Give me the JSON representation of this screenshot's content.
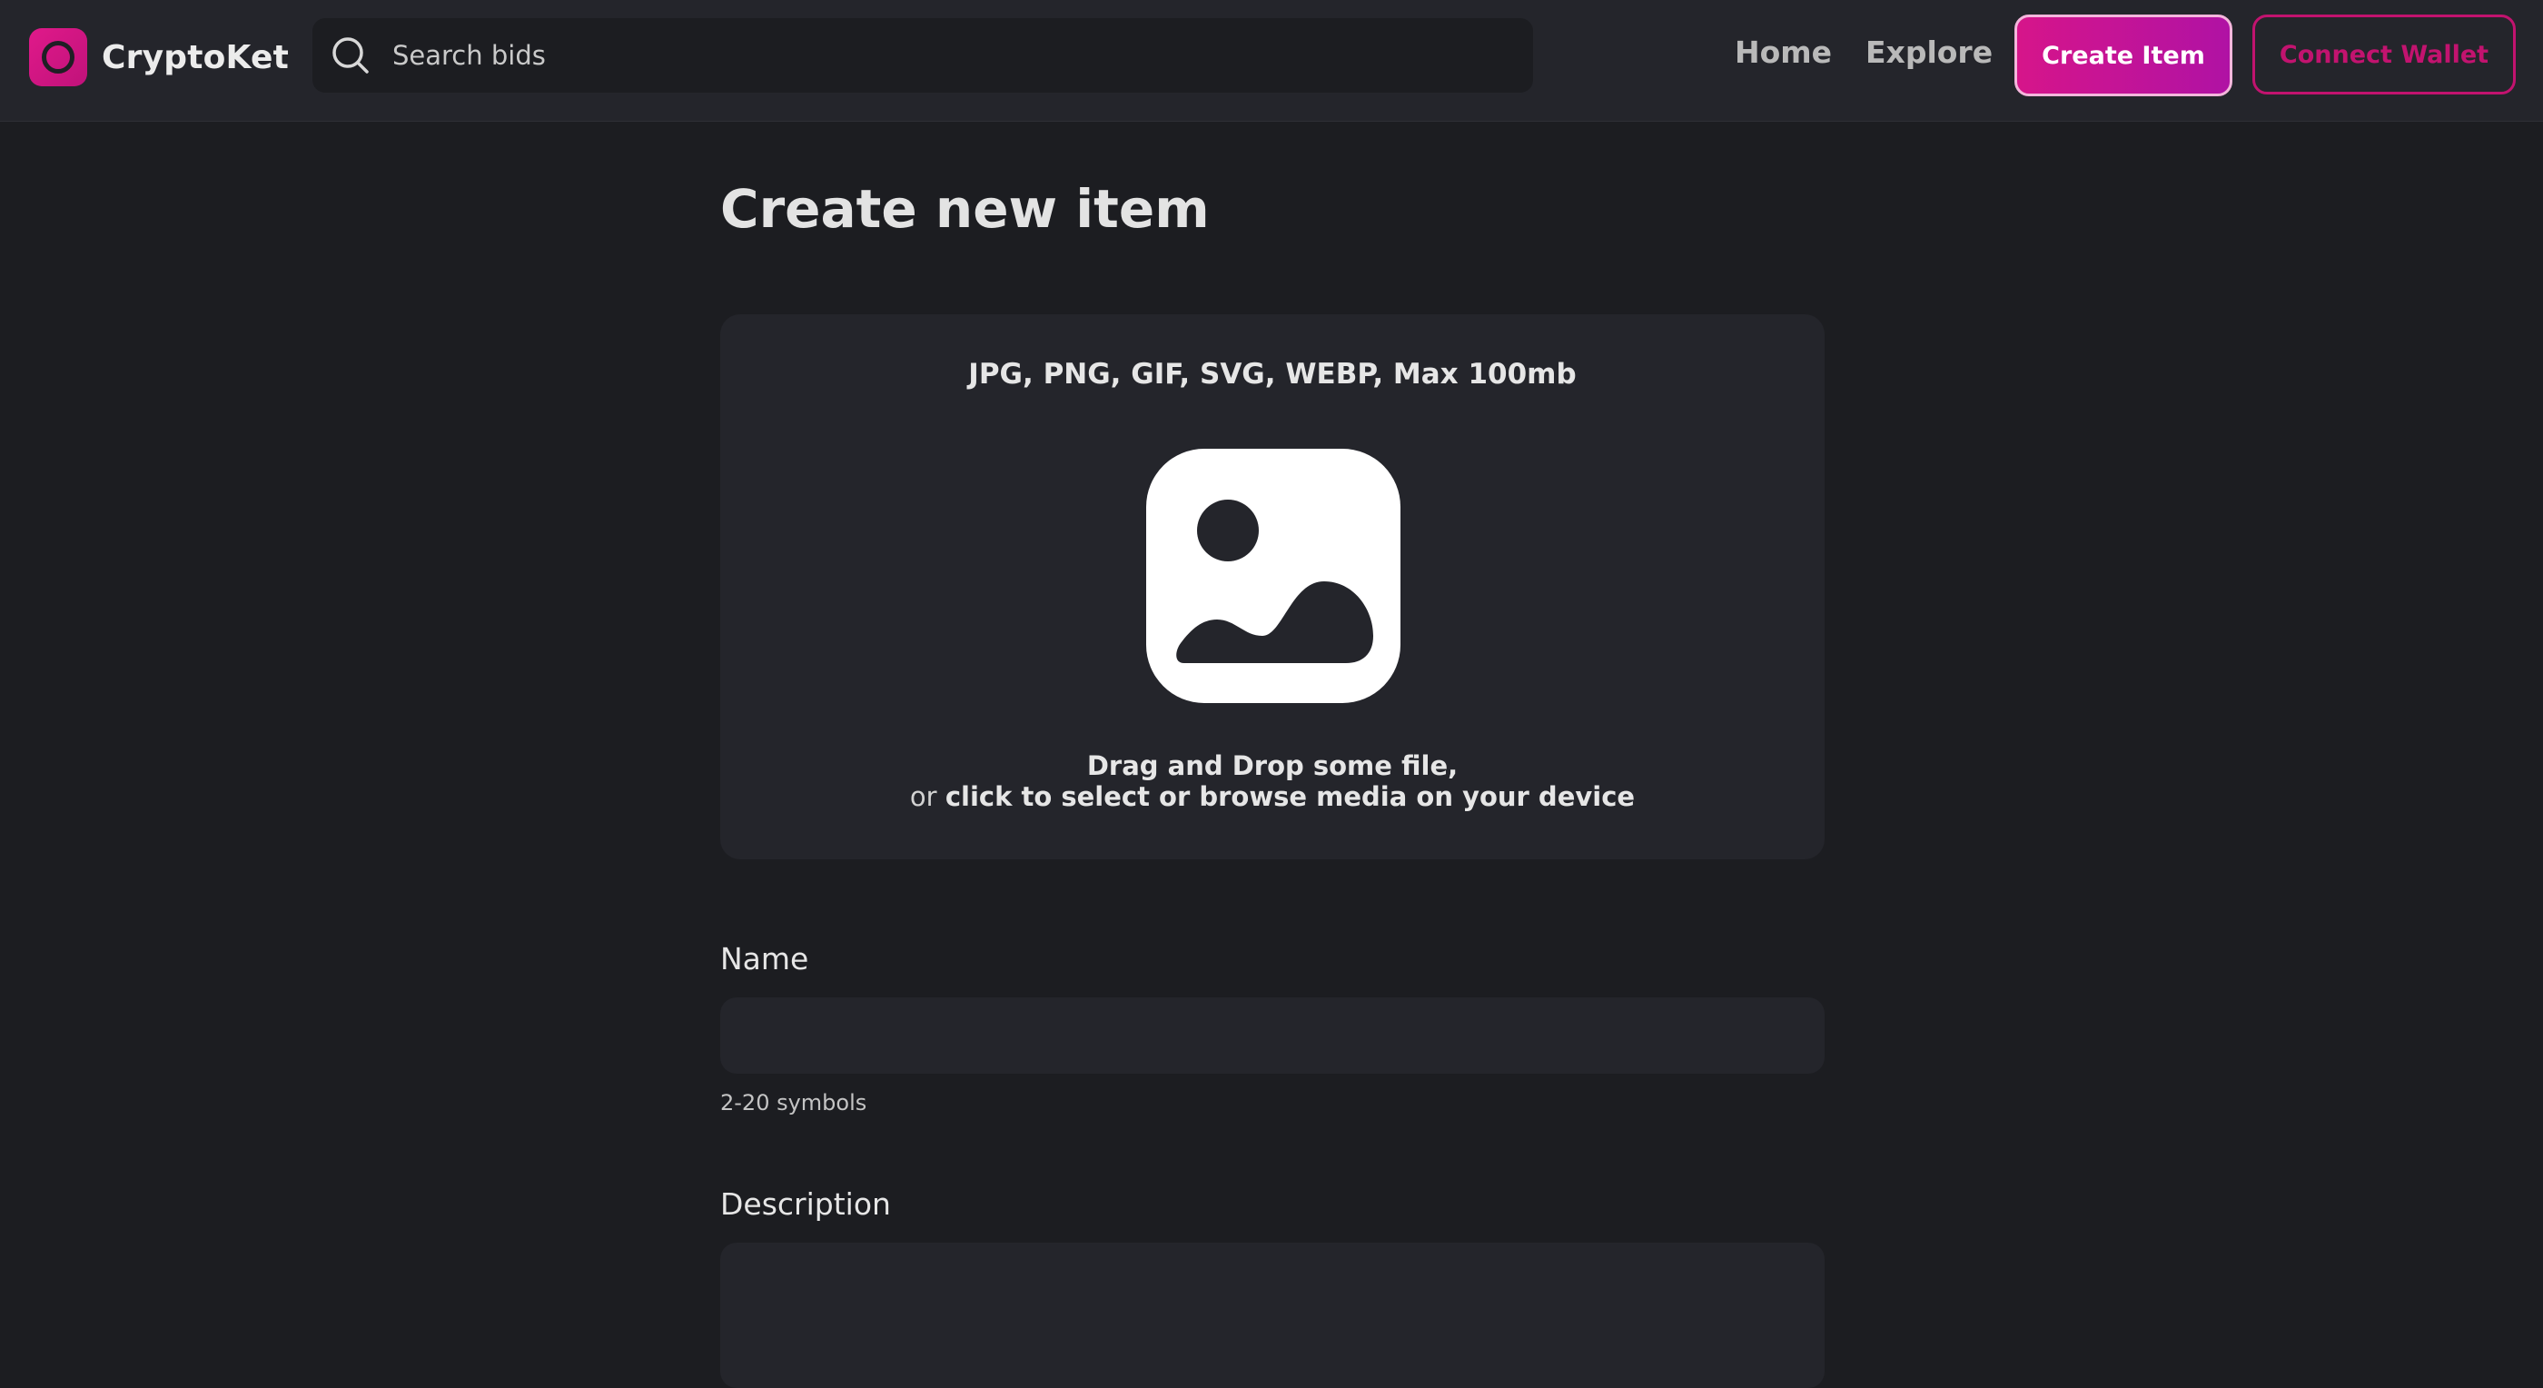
{
  "navbar": {
    "brand": "CryptoKet",
    "search": {
      "placeholder": "Search bids",
      "value": ""
    },
    "links": {
      "home": "Home",
      "explore": "Explore"
    },
    "create_button": "Create Item",
    "connect_button": "Connect Wallet"
  },
  "main": {
    "title": "Create new item",
    "upload": {
      "formats": "JPG, PNG, GIF, SVG, WEBP, Max 100mb",
      "hint_line1": "Drag and Drop some file,",
      "hint_or": "or ",
      "hint_line2": "click to select or browse media on your device"
    },
    "name_field": {
      "label": "Name",
      "value": "",
      "hint": "2-20 symbols"
    },
    "description_field": {
      "label": "Description",
      "value": ""
    }
  },
  "colors": {
    "background": "#1c1d21",
    "surface": "#24252b",
    "accent": "#d6158a",
    "accent_secondary": "#b012a4"
  },
  "icons": [
    "brand-logo-icon",
    "search-icon",
    "image-placeholder-icon"
  ]
}
